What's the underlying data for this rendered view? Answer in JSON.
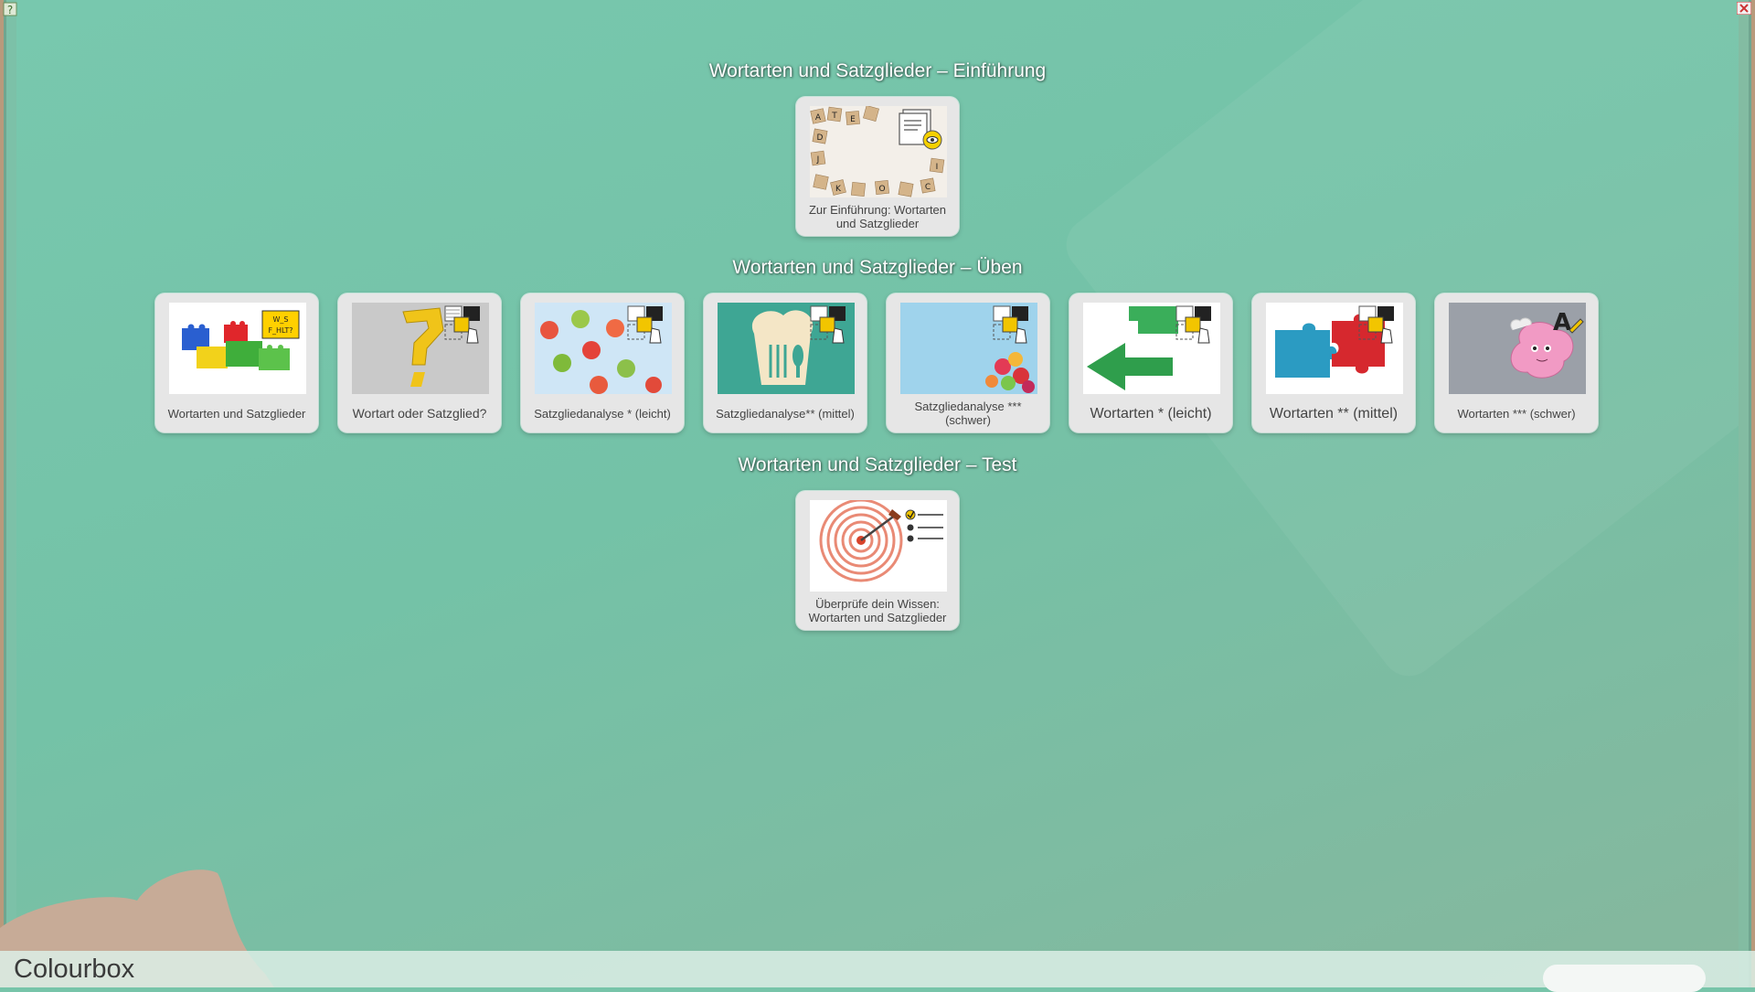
{
  "sections": {
    "intro": {
      "title": "Wortarten und Satzglieder – Einführung"
    },
    "practice": {
      "title": "Wortarten und Satzglieder – Üben"
    },
    "test": {
      "title": "Wortarten und Satzglieder – Test"
    }
  },
  "tiles": {
    "intro": {
      "label": "Zur Einführung: Wortarten und Satzglieder",
      "icon": "reading-eye-icon"
    },
    "p1": {
      "label": "Wortarten und Satzglieder",
      "badge": "W_S F_HLT?"
    },
    "p2": {
      "label": "Wortart oder Satzglied?",
      "icon": "interactive-drag-icon"
    },
    "p3": {
      "label": "Satzgliedanalyse * (leicht)",
      "icon": "interactive-drag-icon"
    },
    "p4": {
      "label": "Satzgliedanalyse** (mittel)",
      "icon": "interactive-drag-icon"
    },
    "p5": {
      "label": "Satzgliedanalyse *** (schwer)",
      "icon": "interactive-drag-icon"
    },
    "p6": {
      "label": "Wortarten * (leicht)",
      "icon": "interactive-drag-icon"
    },
    "p7": {
      "label": "Wortarten ** (mittel)",
      "icon": "interactive-drag-icon"
    },
    "p8": {
      "label": "Wortarten *** (schwer)",
      "icon": "writing-pencil-icon",
      "letter": "A"
    },
    "test": {
      "label": "Überprüfe dein Wissen: Wortarten und Satzglieder",
      "icon": "checklist-icon"
    }
  },
  "footer": {
    "credit": "Colourbox"
  },
  "colors": {
    "board": "#77c4a9",
    "tile": "#e6e6e6",
    "title": "#ffffff"
  }
}
